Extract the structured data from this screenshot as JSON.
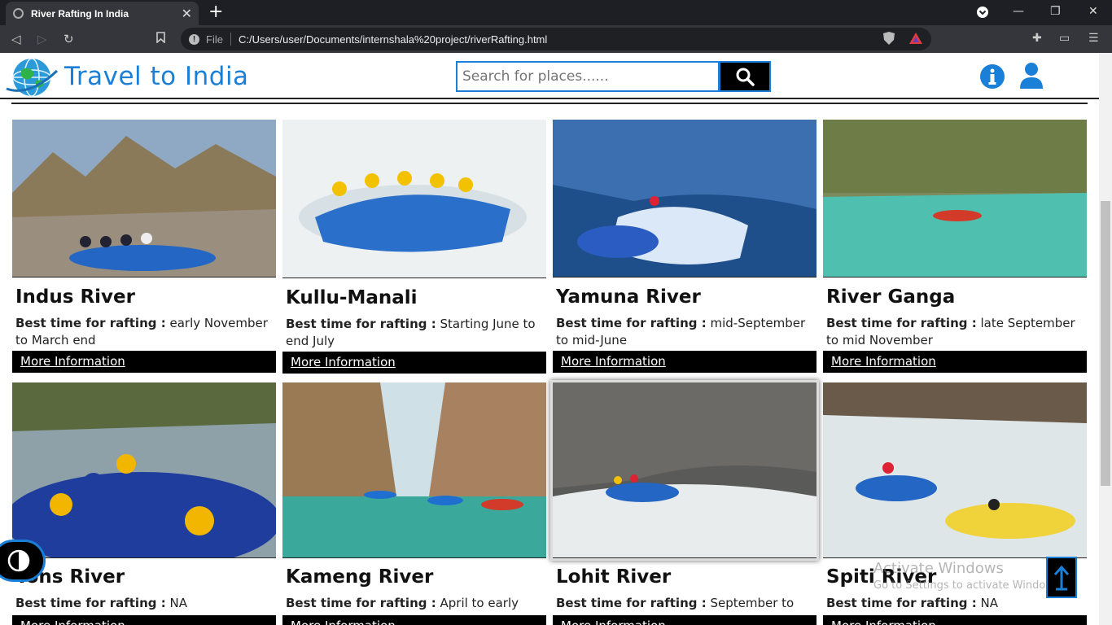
{
  "browser": {
    "tab_title": "River Rafting In India",
    "tab_close": "✕",
    "new_tab": "+",
    "scheme": "File",
    "url": "C:/Users/user/Documents/internshala%20project/riverRafting.html"
  },
  "header": {
    "brand": "Travel to India",
    "search_placeholder": "Search for places......"
  },
  "cards": [
    {
      "title": "Indus River",
      "label": "Best time for rafting :",
      "value": "early November to March end",
      "more": "More Information"
    },
    {
      "title": "Kullu-Manali",
      "label": "Best time for rafting :",
      "value": "Starting June to end July",
      "more": "More Information"
    },
    {
      "title": "Yamuna River",
      "label": "Best time for rafting :",
      "value": "mid-September to mid-June",
      "more": "More Information"
    },
    {
      "title": "River Ganga",
      "label": "Best time for rafting :",
      "value": "late September to mid November",
      "more": "More Information"
    },
    {
      "title": "Tons River",
      "label": "Best time for rafting :",
      "value": "NA",
      "more": "More Information"
    },
    {
      "title": "Kameng River",
      "label": "Best time for rafting :",
      "value": "April to early June",
      "more": "More Information"
    },
    {
      "title": "Lohit River",
      "label": "Best time for rafting :",
      "value": "September to June",
      "more": "More Information"
    },
    {
      "title": "Spiti River",
      "label": "Best time for rafting :",
      "value": "NA",
      "more": "More Information"
    }
  ],
  "watermark": {
    "line1": "Activate Windows",
    "line2": "Go to Settings to activate Windows."
  },
  "colors": {
    "accent": "#1a7fd6"
  }
}
